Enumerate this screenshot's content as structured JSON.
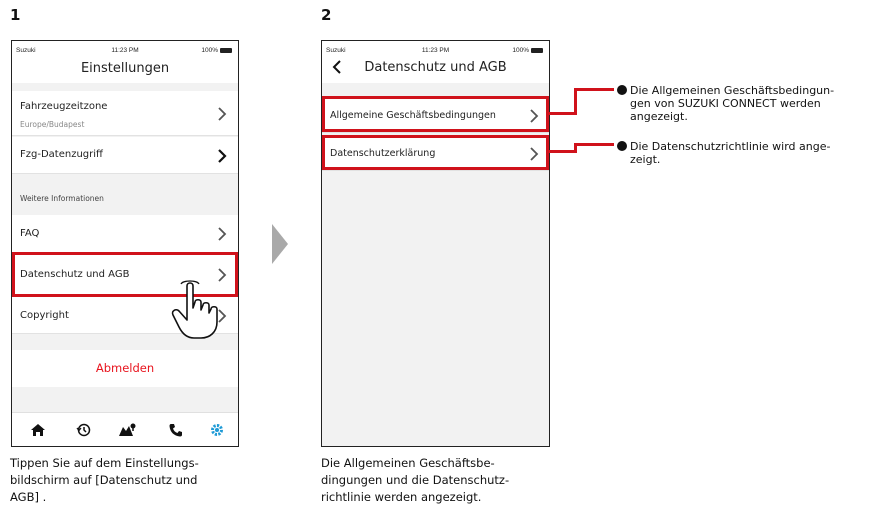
{
  "steps": [
    {
      "number": "1",
      "status": {
        "carrier": "Suzuki",
        "time": "11:23 PM",
        "battery": "100%"
      },
      "title": "Einstellungen",
      "rows": {
        "timezone_label": "Fahrzeugzeitzone",
        "timezone_value": "Europe/Budapest",
        "data_access_label": "Fzg-Datenzugriff",
        "section_header": "Weitere Informationen",
        "faq_label": "FAQ",
        "privacy_label": "Datenschutz und AGB",
        "copyright_label": "Copyright"
      },
      "logout_label": "Abmelden",
      "tabbar": [
        "home-icon",
        "history-icon",
        "map-icon",
        "phone-icon",
        "settings-icon"
      ],
      "caption_lines": [
        "Tippen Sie auf dem Einstellungs-",
        "bildschirm auf [Datenschutz und",
        "AGB] ."
      ]
    },
    {
      "number": "2",
      "status": {
        "carrier": "Suzuki",
        "time": "11:23 PM",
        "battery": "100%"
      },
      "back_icon": "chevron-left-icon",
      "title": "Datenschutz und AGB",
      "rows": {
        "terms_label": "Allgemeine Geschäftsbedingungen",
        "privacy_statement_label": "Datenschutzerklärung"
      },
      "caption_lines": [
        "Die Allgemeinen Geschäftsbe-",
        "dingungen und die Datenschutz-",
        "richtlinie werden angezeigt."
      ]
    }
  ],
  "notes": [
    {
      "lines": [
        "Die Allgemeinen Geschäftsbedingun-",
        "gen von SUZUKI CONNECT werden",
        "angezeigt."
      ]
    },
    {
      "lines": [
        "Die Datenschutzrichtlinie wird ange-",
        "zeigt."
      ]
    }
  ],
  "colors": {
    "highlight": "#d0121b",
    "logout": "#e8141e",
    "settings_tab_active": "#1e9ad6"
  }
}
